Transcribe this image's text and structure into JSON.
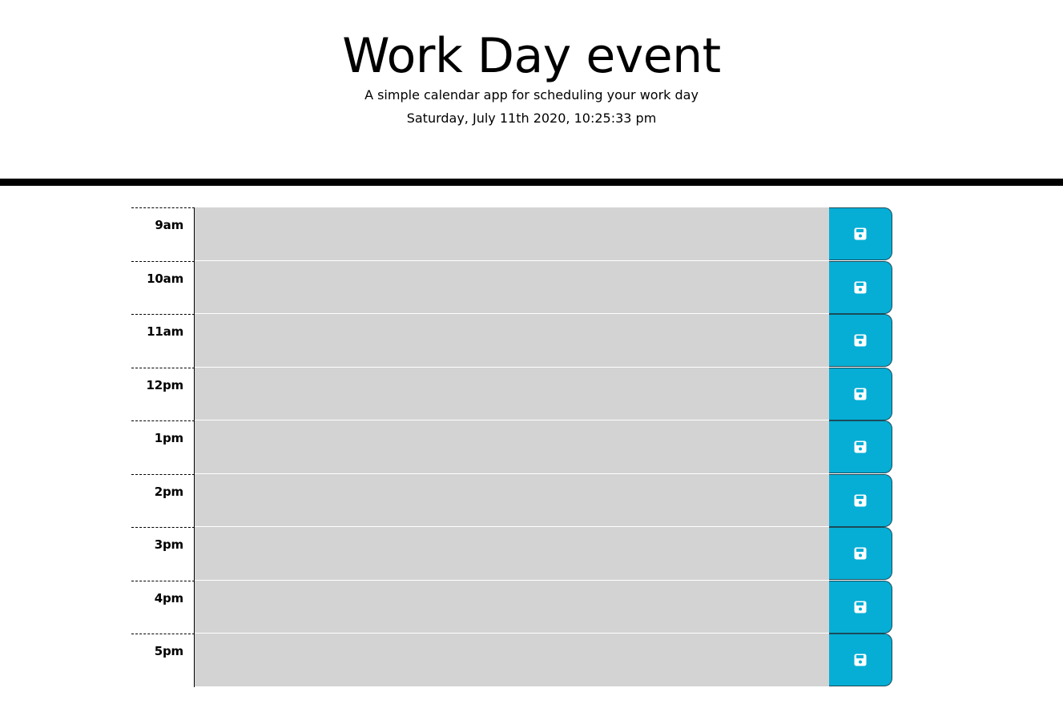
{
  "header": {
    "title": "Work Day event",
    "subtitle": "A simple calendar app for scheduling your work day",
    "current_day": "Saturday, July 11th 2020, 10:25:33 pm"
  },
  "colors": {
    "past": "#d3d3d3",
    "save_button": "#06aed5"
  },
  "icons": {
    "save": "floppy-disk-icon"
  },
  "time_blocks": [
    {
      "hour": "9am",
      "description": ""
    },
    {
      "hour": "10am",
      "description": ""
    },
    {
      "hour": "11am",
      "description": ""
    },
    {
      "hour": "12pm",
      "description": ""
    },
    {
      "hour": "1pm",
      "description": ""
    },
    {
      "hour": "2pm",
      "description": ""
    },
    {
      "hour": "3pm",
      "description": ""
    },
    {
      "hour": "4pm",
      "description": ""
    },
    {
      "hour": "5pm",
      "description": ""
    }
  ]
}
